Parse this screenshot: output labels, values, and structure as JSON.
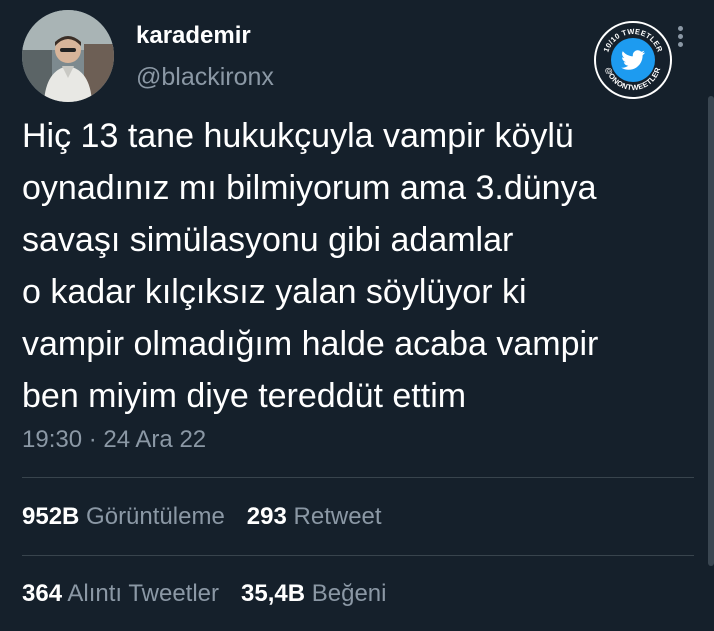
{
  "user": {
    "display_name": "karademir",
    "handle": "@blackironx"
  },
  "badge": {
    "text_top": "10/10 TWEETLER",
    "text_bottom": "@ONONTWEETLER"
  },
  "tweet": {
    "text": "Hiç 13 tane hukukçuyla vampir köylü\noynadınız mı bilmiyorum ama 3.dünya\nsavaşı simülasyonu gibi adamlar\no kadar kılçıksız yalan söylüyor ki\nvampir olmadığım halde acaba vampir\nben miyim diye tereddüt ettim",
    "timestamp": "19:30 · 24 Ara 22"
  },
  "stats": {
    "views_count": "952B",
    "views_label": "Görüntüleme",
    "retweets_count": "293",
    "retweets_label": "Retweet",
    "quotes_count": "364",
    "quotes_label": "Alıntı Tweetler",
    "likes_count": "35,4B",
    "likes_label": "Beğeni"
  },
  "colors": {
    "background": "#15202b",
    "text_primary": "#ffffff",
    "text_secondary": "#8b98a5",
    "divider": "#38444d",
    "twitter_blue": "#1d9bf0"
  },
  "icons": {
    "avatar": "profile-photo",
    "badge": "twitter-bird-icon",
    "more": "more-vertical-icon"
  }
}
